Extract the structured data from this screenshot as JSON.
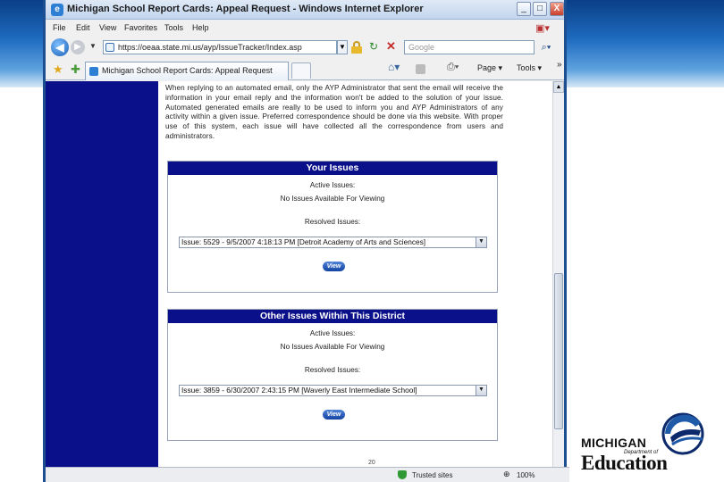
{
  "window": {
    "title": "Michigan School Report Cards: Appeal Request - Windows Internet Explorer",
    "controls": {
      "minimize": "_",
      "maximize": "□",
      "close": "X"
    }
  },
  "menu": [
    "File",
    "Edit",
    "View",
    "Favorites",
    "Tools",
    "Help"
  ],
  "address": {
    "url": "https://oeaa.state.mi.us/ayp/IssueTracker/Index.asp",
    "search_placeholder": "Google"
  },
  "tab": {
    "label": "Michigan School Report Cards: Appeal Request"
  },
  "commands": {
    "page": "Page",
    "tools": "Tools"
  },
  "content": {
    "intro": "When replying to an automated email, only the AYP Administrator that sent the email will receive the information in your email reply and the information won't be added to the solution of your issue. Automated generated emails are really to be used to inform you and AYP Administrators of any activity within a given issue. Preferred correspondence should be done via this website. With proper use of this system, each issue will have collected all the correspondence from users and administrators.",
    "your_issues": {
      "heading": "Your Issues",
      "active_label": "Active Issues:",
      "active_value": "No Issues Available For Viewing",
      "resolved_label": "Resolved Issues:",
      "resolved_selected": "Issue: 5529 - 9/5/2007 4:18:13 PM [Detroit Academy of Arts and Sciences]",
      "view_button": "View"
    },
    "district_issues": {
      "heading": "Other Issues Within This District",
      "active_label": "Active Issues:",
      "active_value": "No Issues Available For Viewing",
      "resolved_label": "Resolved Issues:",
      "resolved_selected": "Issue: 3859 - 6/30/2007 2:43:15 PM [Waverly East Intermediate School]",
      "view_button": "View"
    },
    "page_number": "20"
  },
  "status": {
    "zone": "Trusted sites",
    "zoom": "100%"
  },
  "logo": {
    "line1": "MICHIGAN",
    "line2": "Department of",
    "line3": "Education"
  },
  "colors": {
    "nav_navy": "#0a0f8a",
    "slide_band": "#1f6bc0"
  }
}
